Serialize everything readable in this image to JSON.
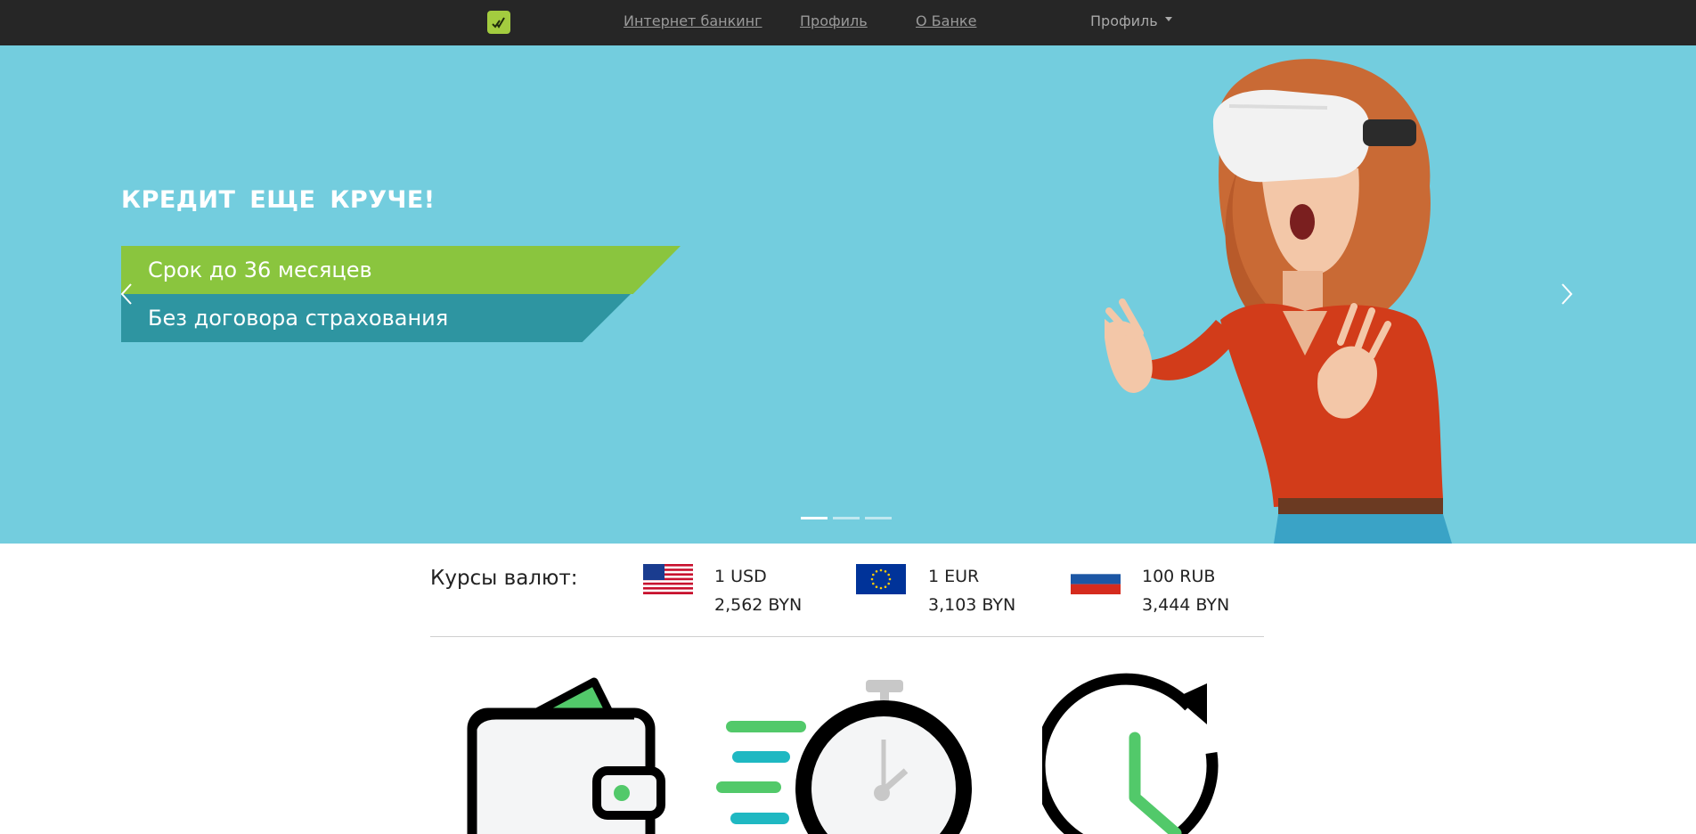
{
  "nav": {
    "links": [
      "Интернет банкинг",
      "Профиль",
      "О Банке"
    ],
    "dropdown_label": "Профиль"
  },
  "hero": {
    "headline": "КРЕДИТ  ЕЩЕ КРУЧЕ!",
    "banner_1": "Срок до 36 месяцев",
    "banner_2": "Без договора страхования",
    "slide_count": 3,
    "active_slide": 1,
    "background_color": "#73cdde",
    "accent_green": "#8ac53e",
    "accent_teal": "#2e95a1"
  },
  "rates": {
    "title": "Курсы валют:",
    "items": [
      {
        "flag": "us-flag-icon",
        "name": "1 USD",
        "value": "2,562 BYN"
      },
      {
        "flag": "eu-flag-icon",
        "name": "1 EUR",
        "value": "3,103 BYN"
      },
      {
        "flag": "ru-flag-icon",
        "name": "100 RUB",
        "value": "3,444 BYN"
      }
    ]
  },
  "features": {
    "icons": [
      "wallet-icon",
      "stopwatch-icon",
      "clock-refresh-icon"
    ]
  }
}
